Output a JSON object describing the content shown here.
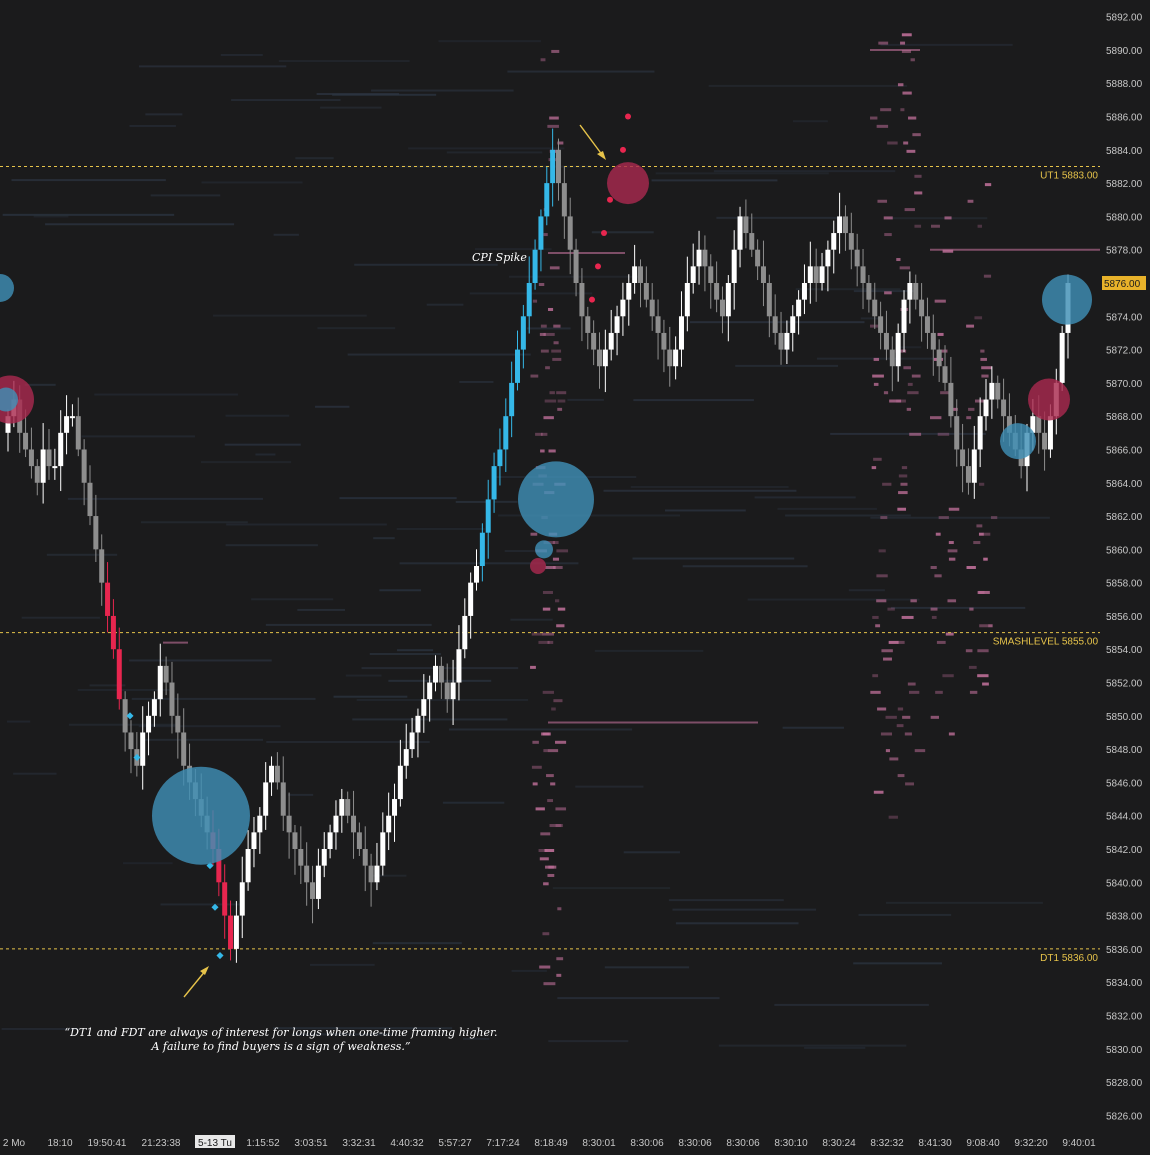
{
  "chart_data": {
    "type": "candlestick",
    "instrument_price_axis": "right",
    "ylim": [
      5825,
      5893
    ],
    "y_ticks": [
      "5892.00",
      "5890.00",
      "5888.00",
      "5886.00",
      "5884.00",
      "5882.00",
      "5880.00",
      "5878.00",
      "5876.00",
      "5874.00",
      "5872.00",
      "5870.00",
      "5868.00",
      "5866.00",
      "5864.00",
      "5862.00",
      "5860.00",
      "5858.00",
      "5856.00",
      "5854.00",
      "5852.00",
      "5850.00",
      "5848.00",
      "5846.00",
      "5844.00",
      "5842.00",
      "5840.00",
      "5838.00",
      "5836.00",
      "5834.00",
      "5832.00",
      "5830.00",
      "5828.00",
      "5826.00"
    ],
    "x_ticks": [
      "2 Mo",
      "18:10",
      "19:50:41",
      "21:23:38",
      "5-13 Tu",
      "1:15:52",
      "3:03:51",
      "3:32:31",
      "4:40:32",
      "5:57:27",
      "7:17:24",
      "8:18:49",
      "8:30:01",
      "8:30:06",
      "8:30:06",
      "8:30:06",
      "8:30:10",
      "8:30:24",
      "8:32:32",
      "8:41:30",
      "9:08:40",
      "9:32:20",
      "9:40:01"
    ],
    "highlighted_x_tick": "5-13 Tu",
    "last_price": "5876.00",
    "levels": [
      {
        "label": "UT1",
        "price_label": "5883.00",
        "value": 5883
      },
      {
        "label": "SMASHLEVEL",
        "price_label": "5855.00",
        "value": 5855
      },
      {
        "label": "DT1",
        "price_label": "5836.00",
        "value": 5836
      }
    ],
    "closes": [
      5868,
      5869,
      5867,
      5866,
      5865,
      5864,
      5866,
      5865,
      5865,
      5867,
      5868,
      5868,
      5866,
      5864,
      5862,
      5860,
      5858,
      5856,
      5854,
      5851,
      5849,
      5848,
      5847,
      5849,
      5850,
      5851,
      5853,
      5852,
      5850,
      5849,
      5847,
      5846,
      5845,
      5844,
      5843,
      5842,
      5840,
      5838,
      5836,
      5838,
      5840,
      5842,
      5843,
      5844,
      5846,
      5847,
      5846,
      5844,
      5843,
      5842,
      5841,
      5840,
      5839,
      5841,
      5842,
      5843,
      5844,
      5845,
      5844,
      5843,
      5842,
      5841,
      5840,
      5841,
      5843,
      5844,
      5845,
      5847,
      5848,
      5849,
      5850,
      5851,
      5852,
      5853,
      5852,
      5851,
      5852,
      5854,
      5856,
      5858,
      5859,
      5861,
      5863,
      5865,
      5866,
      5868,
      5870,
      5872,
      5874,
      5876,
      5878,
      5880,
      5882,
      5884,
      5882,
      5880,
      5878,
      5876,
      5874,
      5873,
      5872,
      5871,
      5872,
      5873,
      5874,
      5875,
      5876,
      5877,
      5876,
      5875,
      5874,
      5873,
      5872,
      5871,
      5872,
      5874,
      5876,
      5877,
      5878,
      5877,
      5876,
      5875,
      5874,
      5876,
      5878,
      5880,
      5879,
      5878,
      5877,
      5876,
      5874,
      5873,
      5872,
      5873,
      5874,
      5875,
      5876,
      5877,
      5876,
      5877,
      5878,
      5879,
      5880,
      5879,
      5878,
      5877,
      5876,
      5875,
      5874,
      5873,
      5872,
      5871,
      5873,
      5875,
      5876,
      5875,
      5874,
      5873,
      5872,
      5871,
      5870,
      5868,
      5866,
      5865,
      5864,
      5866,
      5868,
      5869,
      5870,
      5869,
      5868,
      5867,
      5866,
      5865,
      5867,
      5868,
      5867,
      5866,
      5868,
      5870,
      5873,
      5876
    ]
  },
  "annotations": {
    "cpi": "CPI Spike",
    "quote_line1": "“DT1 and FDT are always of interest for longs when one-time framing higher.",
    "quote_line2": "A failure to find buyers is a sign of weakness.”"
  },
  "colors": {
    "background": "#1b1b1c",
    "bull": "#ffffff",
    "bear": "#8e8e8e",
    "spike": "#35b8e8",
    "sell": "#e8264f",
    "level": "#e6c34a",
    "buy_bubble": "#3f8fb5",
    "sell_bubble": "#a8294e",
    "heat": "#c0709a",
    "grid_text": "#c8c8c8",
    "axis_bg": "#1b1b1c",
    "last_price_bg": "#e8b22a"
  }
}
